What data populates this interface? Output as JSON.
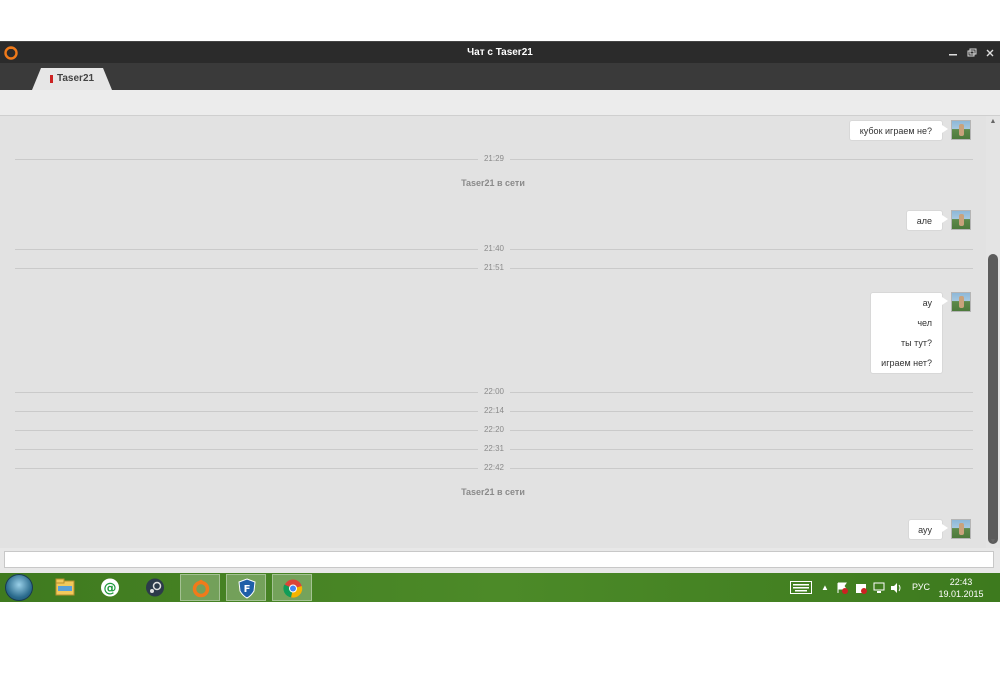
{
  "window": {
    "title": "Чат с Taser21",
    "controls": [
      "minimize-icon",
      "restore-icon",
      "close-icon"
    ]
  },
  "tab": {
    "label": "Taser21",
    "marker_color": "#cc2222"
  },
  "chat": {
    "messages": [
      {
        "lines": [
          "кубок играем не?"
        ]
      },
      {
        "lines": [
          "але"
        ]
      },
      {
        "lines": [
          "ау",
          "чел",
          "ты тут?",
          "играем нет?"
        ]
      },
      {
        "lines": [
          "ауу"
        ]
      }
    ],
    "timestamps": [
      "21:29",
      "21:40",
      "21:51",
      "22:00",
      "22:14",
      "22:20",
      "22:31",
      "22:42"
    ],
    "status_events": [
      "Taser21 в сети",
      "Taser21 в сети"
    ]
  },
  "input": {
    "value": "",
    "placeholder": ""
  },
  "taskbar": {
    "apps": [
      "file-explorer-icon",
      "mail-agent-icon",
      "steam-icon",
      "origin-icon",
      "f-secure-icon",
      "chrome-icon"
    ],
    "active_app": "origin-icon",
    "tray": {
      "language": "РУС",
      "time": "22:43",
      "date": "19.01.2015"
    }
  },
  "colors": {
    "titlebar": "#2b2b2b",
    "tabbar": "#3a3a3a",
    "chat_bg": "#e2e2e2",
    "bubble_bg": "#ffffff",
    "taskbar": "#4c8a28",
    "accent_orange": "#f07a1a"
  }
}
